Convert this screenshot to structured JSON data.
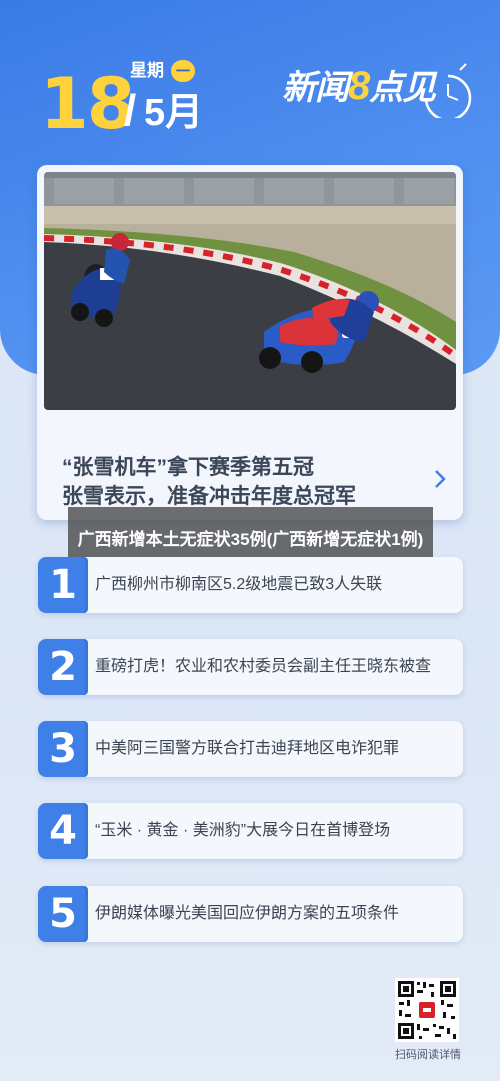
{
  "header": {
    "day": "18",
    "slash": "/",
    "month": "5月",
    "weekday_label": "星期",
    "weekday_value": "一",
    "brand_prefix": "新闻",
    "brand_number": "8",
    "brand_suffix": "点见"
  },
  "featured": {
    "title_line1": "“张雪机车”拿下赛季第五冠",
    "title_line2": "张雪表示，准备冲击年度总冠军",
    "arrow_icon": "chevron-right-icon"
  },
  "overlay_title": "广西新增本土无症状35例(广西新增无症状1例)",
  "news": [
    {
      "num": "1",
      "text": "广西柳州市柳南区5.2级地震已致3人失联"
    },
    {
      "num": "2",
      "text": "重磅打虎！农业和农村委员会副主任王晓东被查"
    },
    {
      "num": "3",
      "text": "中美阿三国警方联合打击迪拜地区电诈犯罪"
    },
    {
      "num": "4",
      "text": "“玉米 · 黄金 · 美洲豹”大展今日在首博登场"
    },
    {
      "num": "5",
      "text": "伊朗媒体曝光美国回应伊朗方案的五项条件"
    }
  ],
  "qr": {
    "label": "扫码阅读详情",
    "icon": "qr-code-icon"
  },
  "colors": {
    "accent_blue": "#3f7fe8",
    "accent_yellow": "#ffd23c"
  }
}
